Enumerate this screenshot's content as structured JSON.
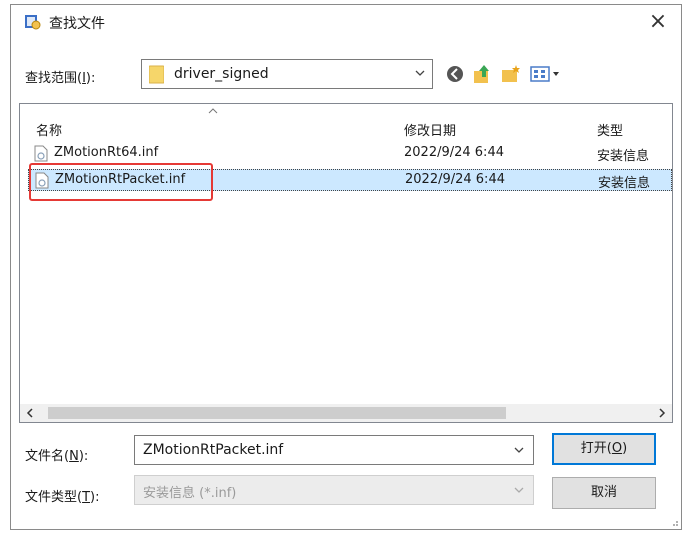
{
  "window": {
    "title": "查找文件",
    "close_icon": "×"
  },
  "toolbar": {
    "look_in_label": "查找范围(",
    "look_in_key": "I",
    "look_in_suffix": "):",
    "current_folder": "driver_signed",
    "icons": [
      "back-icon",
      "up-folder-icon",
      "new-folder-icon",
      "view-menu-icon"
    ]
  },
  "list": {
    "columns": [
      "名称",
      "修改日期",
      "类型"
    ],
    "rows": [
      {
        "name": "ZMotionRt64.inf",
        "date": "2022/9/24 6:44",
        "type": "安装信息",
        "selected": false
      },
      {
        "name": "ZMotionRtPacket.inf",
        "date": "2022/9/24 6:44",
        "type": "安装信息",
        "selected": true
      }
    ]
  },
  "form": {
    "filename_label": "文件名(",
    "filename_key": "N",
    "filename_suffix": "):",
    "filename_value": "ZMotionRtPacket.inf",
    "filetype_label": "文件类型(",
    "filetype_key": "T",
    "filetype_suffix": "):",
    "filetype_value": "安装信息 (*.inf)"
  },
  "buttons": {
    "open_label": "打开(",
    "open_key": "O",
    "open_suffix": ")",
    "cancel_label": "取消"
  },
  "colors": {
    "selection": "#cce8ff",
    "accent": "#0078d7",
    "annotation": "#e53935"
  }
}
